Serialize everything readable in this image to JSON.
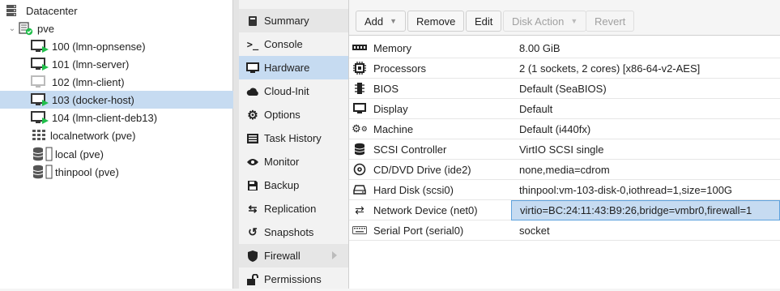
{
  "tree": {
    "datacenter": "Datacenter",
    "node": "pve",
    "vms": [
      {
        "label": "100 (lmn-opnsense)",
        "running": true
      },
      {
        "label": "101 (lmn-server)",
        "running": true
      },
      {
        "label": "102 (lmn-client)",
        "running": false
      },
      {
        "label": "103 (docker-host)",
        "running": true,
        "selected": true
      },
      {
        "label": "104 (lmn-client-deb13)",
        "running": true
      }
    ],
    "network": "localnetwork (pve)",
    "storages": [
      "local (pve)",
      "thinpool (pve)"
    ]
  },
  "nav": {
    "items": [
      {
        "label": "Summary",
        "icon": "book-icon"
      },
      {
        "label": "Console",
        "icon": "terminal-icon"
      },
      {
        "label": "Hardware",
        "icon": "monitor-icon",
        "selected": true
      },
      {
        "label": "Cloud-Init",
        "icon": "cloud-icon"
      },
      {
        "label": "Options",
        "icon": "gear-icon"
      },
      {
        "label": "Task History",
        "icon": "list-icon"
      },
      {
        "label": "Monitor",
        "icon": "eye-icon"
      },
      {
        "label": "Backup",
        "icon": "floppy-icon"
      },
      {
        "label": "Replication",
        "icon": "retweet-icon"
      },
      {
        "label": "Snapshots",
        "icon": "history-icon"
      },
      {
        "label": "Firewall",
        "icon": "shield-icon",
        "has_submenu": true
      },
      {
        "label": "Permissions",
        "icon": "unlock-icon"
      }
    ]
  },
  "toolbar": {
    "add": "Add",
    "remove": "Remove",
    "edit": "Edit",
    "disk_action": "Disk Action",
    "revert": "Revert"
  },
  "hardware": {
    "rows": [
      {
        "key": "Memory",
        "value": "8.00 GiB",
        "icon": "memory-icon"
      },
      {
        "key": "Processors",
        "value": "2 (1 sockets, 2 cores) [x86-64-v2-AES]",
        "icon": "cpu-icon"
      },
      {
        "key": "BIOS",
        "value": "Default (SeaBIOS)",
        "icon": "chip-icon"
      },
      {
        "key": "Display",
        "value": "Default",
        "icon": "desktop-icon"
      },
      {
        "key": "Machine",
        "value": "Default (i440fx)",
        "icon": "cogs-icon"
      },
      {
        "key": "SCSI Controller",
        "value": "VirtIO SCSI single",
        "icon": "database-icon"
      },
      {
        "key": "CD/DVD Drive (ide2)",
        "value": "none,media=cdrom",
        "icon": "cdrom-icon"
      },
      {
        "key": "Hard Disk (scsi0)",
        "value": "thinpool:vm-103-disk-0,iothread=1,size=100G",
        "icon": "hdd-icon"
      },
      {
        "key": "Network Device (net0)",
        "value": "virtio=BC:24:11:43:B9:26,bridge=vmbr0,firewall=1",
        "icon": "exchange-icon",
        "selected": true
      },
      {
        "key": "Serial Port (serial0)",
        "value": "socket",
        "icon": "keyboard-icon"
      }
    ]
  },
  "colors": {
    "selection": "#c6dbf1",
    "running": "#21bf4b",
    "selection_border": "#5fa2dd"
  }
}
